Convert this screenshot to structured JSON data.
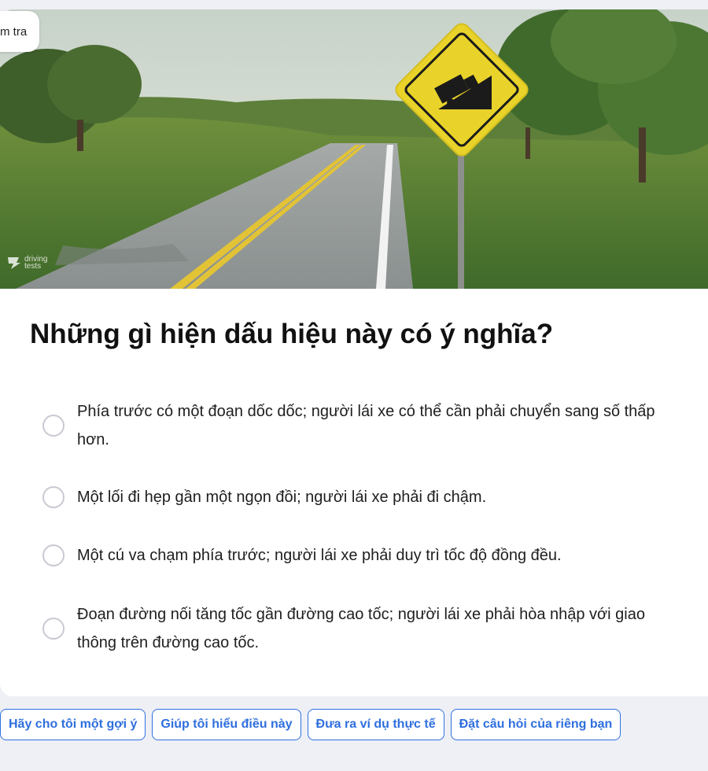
{
  "header": {
    "tag_label": "m tra",
    "watermark": "driving tests"
  },
  "question": {
    "text": "Những gì hiện dấu hiệu này có ý nghĩa?",
    "image_icon": "hill-truck-warning-sign-icon",
    "options": [
      {
        "label": "Phía trước có một đoạn dốc dốc; người lái xe có thể cần phải chuyển sang số thấp hơn.",
        "selected": false
      },
      {
        "label": "Một lối đi hẹp gần một ngọn đồi; người lái xe phải đi chậm.",
        "selected": false
      },
      {
        "label": "Một cú va chạm phía trước; người lái xe phải duy trì tốc độ đồng đều.",
        "selected": false
      },
      {
        "label": "Đoạn đường nối tăng tốc gần đường cao tốc; người lái xe phải hòa nhập với giao thông trên đường cao tốc.",
        "selected": false
      }
    ]
  },
  "actions": [
    {
      "label": "Hãy cho tôi một gợi ý"
    },
    {
      "label": "Giúp tôi hiểu điều này"
    },
    {
      "label": "Đưa ra ví dụ thực tế"
    },
    {
      "label": "Đặt câu hỏi của riêng bạn"
    }
  ],
  "colors": {
    "accent": "#2f6fde",
    "page_bg": "#eef0f5",
    "sign_yellow": "#e9d32a"
  }
}
